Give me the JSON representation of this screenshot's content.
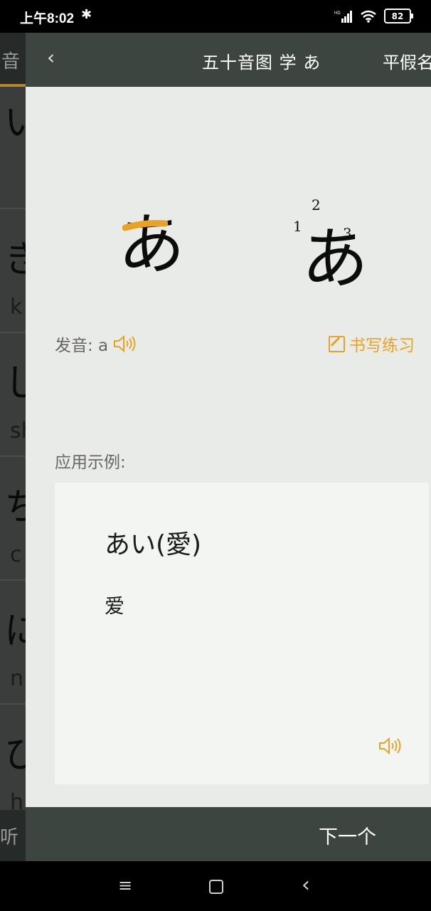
{
  "status_bar": {
    "time": "上午8:02",
    "bluetooth_icon": "bluetooth-icon",
    "signal_label": "HD",
    "battery": "82"
  },
  "background_page": {
    "header_text": "音",
    "rows": [
      {
        "kana": "い",
        "romaji": ""
      },
      {
        "kana": "き",
        "romaji": "k"
      },
      {
        "kana": "し",
        "romaji": "sh"
      },
      {
        "kana": "ち",
        "romaji": "c"
      },
      {
        "kana": "に",
        "romaji": "n"
      },
      {
        "kana": "ひ",
        "romaji": "h"
      }
    ],
    "footer_text": "听"
  },
  "header": {
    "back_icon": "‹",
    "title": "五十音图 学 あ",
    "right_text": "平假名"
  },
  "kana": {
    "character": "あ",
    "stroke_numbers": [
      "1",
      "2",
      "3"
    ],
    "highlight_color": "#e8a324"
  },
  "pronunciation": {
    "label": "发音: a",
    "write_practice": "书写练习"
  },
  "example": {
    "label": "应用示例:",
    "word": "あい(愛)",
    "meaning": "爱"
  },
  "footer": {
    "next_label": "下一个"
  },
  "nav_bar": {
    "menu_icon": "≡",
    "back_icon": "‹"
  },
  "colors": {
    "accent": "#e8a324",
    "header_bg": "#3d4540",
    "panel_bg": "#e9ebe8"
  }
}
